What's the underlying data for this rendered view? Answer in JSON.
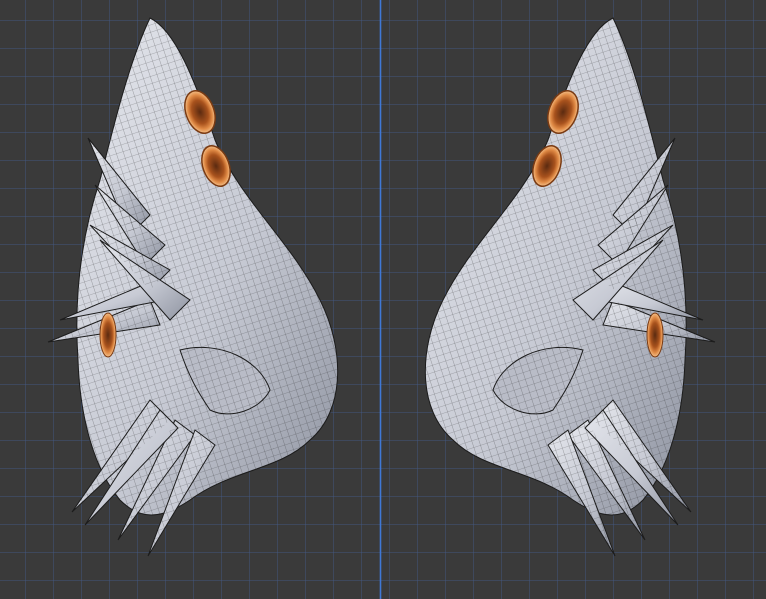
{
  "viewport": {
    "background_color": "#3a3a3a",
    "grid_color": "#4a6fb8",
    "axis_color": "#3f78d6",
    "mesh_fill_color": "#c9ccd6",
    "wire_color": "#1c1c1c",
    "accent_color": "#c56a2a",
    "objects": [
      {
        "name": "left-wing-mesh"
      },
      {
        "name": "right-wing-mesh"
      }
    ]
  }
}
